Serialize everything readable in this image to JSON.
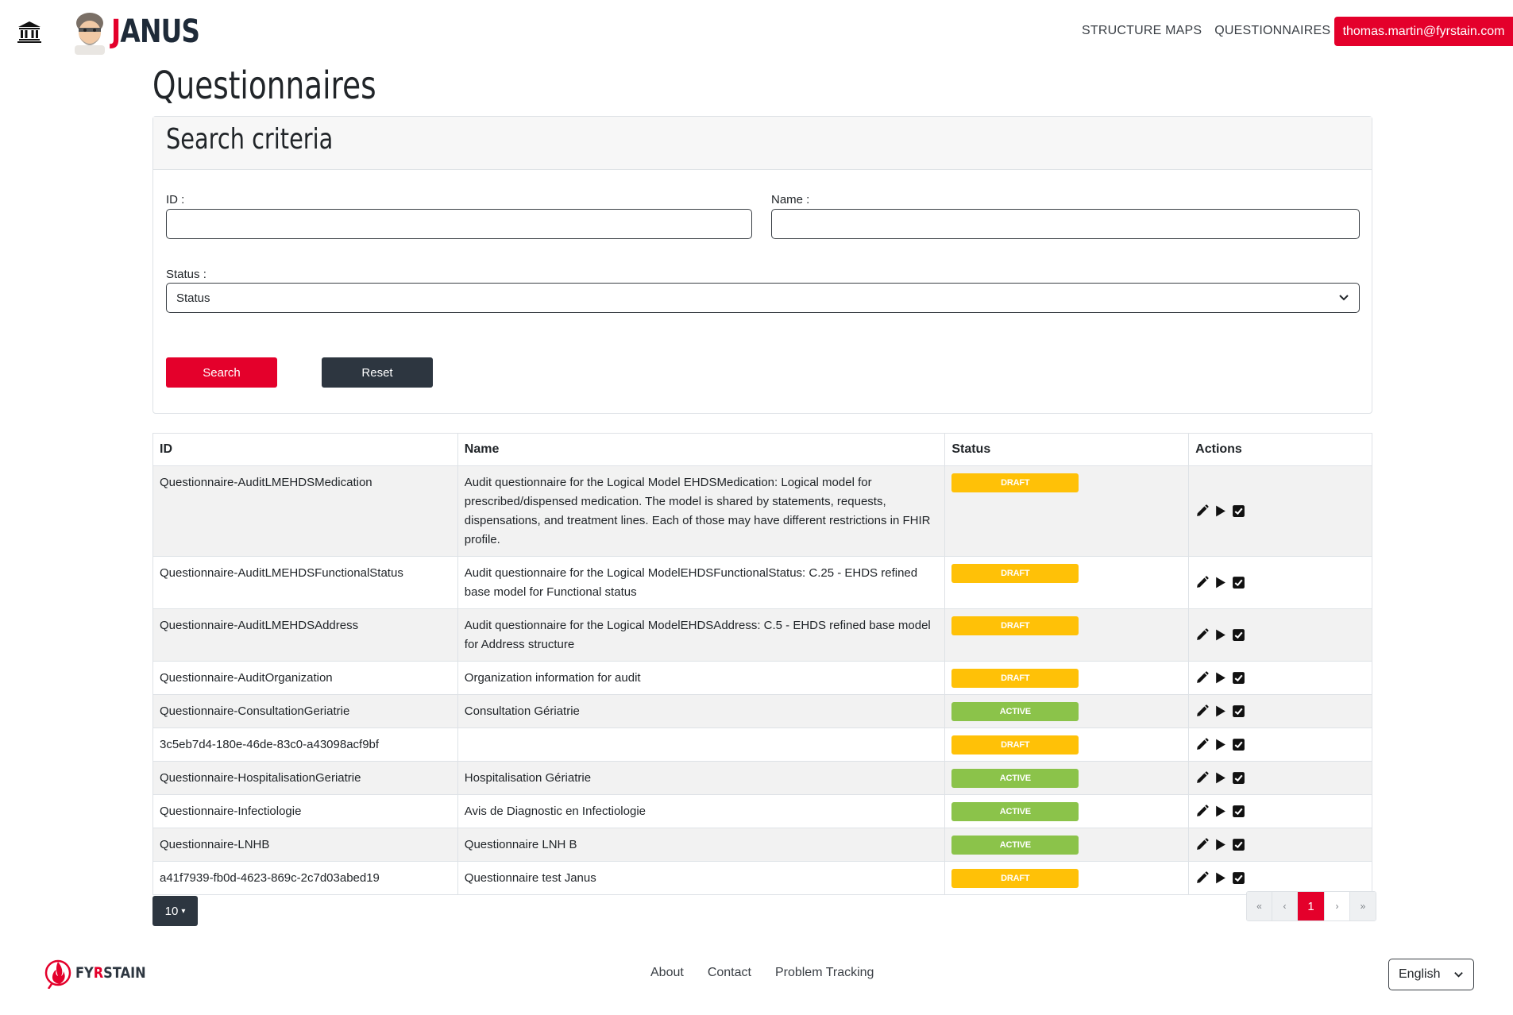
{
  "nav": {
    "brand": "JANUS",
    "links": [
      "STRUCTURE MAPS",
      "QUESTIONNAIRES"
    ],
    "user": "thomas.martin@fyrstain.com"
  },
  "page": {
    "title": "Questionnaires"
  },
  "search": {
    "title": "Search criteria",
    "id_label": "ID :",
    "id_value": "",
    "name_label": "Name :",
    "name_value": "",
    "status_label": "Status :",
    "status_placeholder": "Status",
    "search_button": "Search",
    "reset_button": "Reset"
  },
  "table": {
    "headers": [
      "ID",
      "Name",
      "Status",
      "Actions"
    ],
    "rows": [
      {
        "id": "Questionnaire-AuditLMEHDSMedication",
        "name": "Audit questionnaire for the Logical Model EHDSMedication: Logical model for prescribed/dispensed medication. The model is shared by statements, requests, dispensations, and treatment lines. Each of those may have different restrictions in FHIR profile.",
        "status": "DRAFT"
      },
      {
        "id": "Questionnaire-AuditLMEHDSFunctionalStatus",
        "name": "Audit questionnaire for the Logical ModelEHDSFunctionalStatus: C.25 - EHDS refined base model for Functional status",
        "status": "DRAFT"
      },
      {
        "id": "Questionnaire-AuditLMEHDSAddress",
        "name": "Audit questionnaire for the Logical ModelEHDSAddress: C.5 - EHDS refined base model for Address structure",
        "status": "DRAFT"
      },
      {
        "id": "Questionnaire-AuditOrganization",
        "name": "Organization information for audit",
        "status": "DRAFT"
      },
      {
        "id": "Questionnaire-ConsultationGeriatrie",
        "name": "Consultation Gériatrie",
        "status": "ACTIVE"
      },
      {
        "id": "3c5eb7d4-180e-46de-83c0-a43098acf9bf",
        "name": "",
        "status": "DRAFT"
      },
      {
        "id": "Questionnaire-HospitalisationGeriatrie",
        "name": "Hospitalisation Gériatrie",
        "status": "ACTIVE"
      },
      {
        "id": "Questionnaire-Infectiologie",
        "name": "Avis de Diagnostic en Infectiologie",
        "status": "ACTIVE"
      },
      {
        "id": "Questionnaire-LNHB",
        "name": "Questionnaire LNH B",
        "status": "ACTIVE"
      },
      {
        "id": "a41f7939-fb0d-4623-869c-2c7d03abed19",
        "name": "Questionnaire test Janus",
        "status": "DRAFT"
      }
    ],
    "action_icons": [
      "pencil-icon",
      "play-icon",
      "checkbox-icon"
    ]
  },
  "status_colors": {
    "DRAFT": "#ffc107",
    "ACTIVE": "#8bc34a"
  },
  "pagination": {
    "page_size": "10",
    "first": "«",
    "prev": "‹",
    "current": "1",
    "next": "›",
    "last": "»"
  },
  "footer": {
    "brand": "FYRSTAIN",
    "links": [
      "About",
      "Contact",
      "Problem Tracking"
    ],
    "language": "English"
  },
  "colors": {
    "brand_red": "#e4002b",
    "dark": "#2d3640"
  }
}
